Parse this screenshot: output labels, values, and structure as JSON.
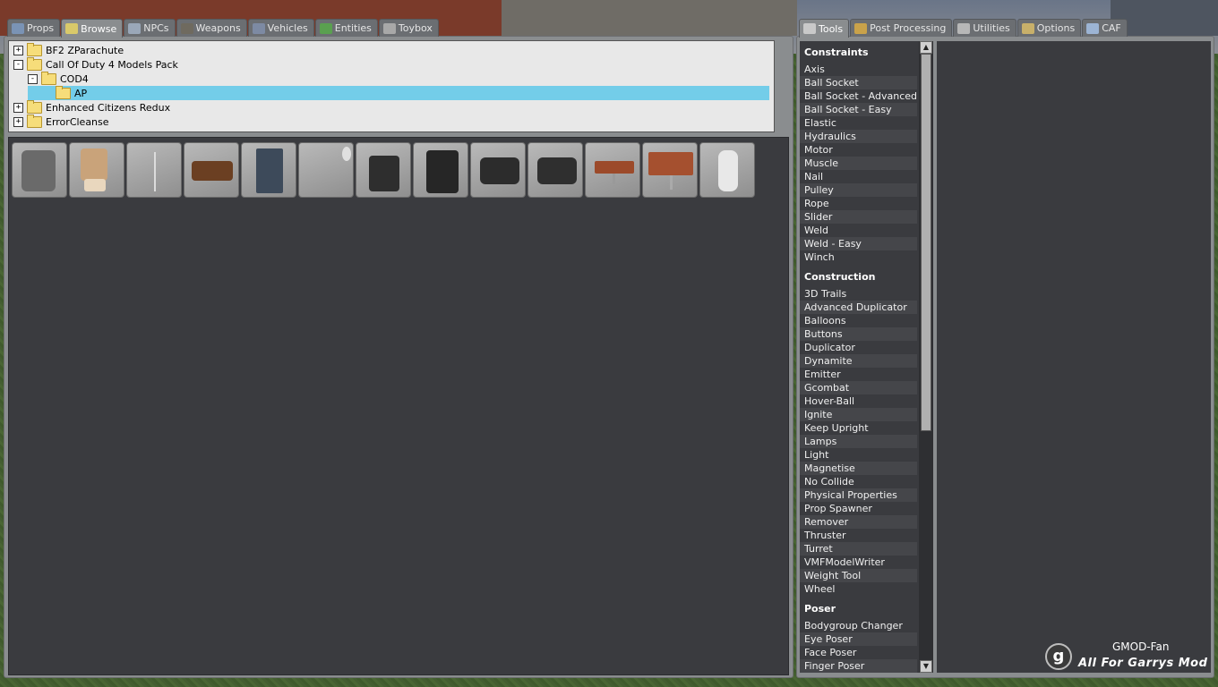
{
  "left_tabs": [
    {
      "label": "Props",
      "icon": "props-icon"
    },
    {
      "label": "Browse",
      "icon": "browse-icon",
      "active": true
    },
    {
      "label": "NPCs",
      "icon": "npcs-icon"
    },
    {
      "label": "Weapons",
      "icon": "weapons-icon"
    },
    {
      "label": "Vehicles",
      "icon": "vehicles-icon"
    },
    {
      "label": "Entities",
      "icon": "entities-icon"
    },
    {
      "label": "Toybox",
      "icon": "toybox-icon"
    }
  ],
  "right_tabs": [
    {
      "label": "Tools",
      "icon": "wrench-icon",
      "active": true
    },
    {
      "label": "Post Processing",
      "icon": "post-processing-icon"
    },
    {
      "label": "Utilities",
      "icon": "utilities-icon"
    },
    {
      "label": "Options",
      "icon": "options-icon"
    },
    {
      "label": "CAF",
      "icon": "caf-icon"
    }
  ],
  "tree": [
    {
      "label": "BF2 ZParachute",
      "expander": "+",
      "level": 0
    },
    {
      "label": "Call Of Duty 4 Models Pack",
      "expander": "-",
      "level": 0
    },
    {
      "label": "COD4",
      "expander": "-",
      "level": 1
    },
    {
      "label": "AP",
      "expander": "",
      "level": 2,
      "selected": true
    },
    {
      "label": "Enhanced Citizens Redux",
      "expander": "+",
      "level": 0
    },
    {
      "label": "ErrorCleanse",
      "expander": "+",
      "level": 0
    }
  ],
  "models": [
    "armchair-model",
    "cinema-seat-model",
    "stand-model",
    "sofa-model",
    "vending-machine-model",
    "blank-model",
    "rolling-luggage-model",
    "tall-luggage-model",
    "suitcase-model",
    "duffel-case-model",
    "small-table-model",
    "square-table-model",
    "tube-model"
  ],
  "categories": [
    {
      "title": "Constraints",
      "items": [
        "Axis",
        "Ball Socket",
        "Ball Socket - Advanced",
        "Ball Socket - Easy",
        "Elastic",
        "Hydraulics",
        "Motor",
        "Muscle",
        "Nail",
        "Pulley",
        "Rope",
        "Slider",
        "Weld",
        "Weld - Easy",
        "Winch"
      ]
    },
    {
      "title": "Construction",
      "items": [
        "3D Trails",
        "Advanced Duplicator",
        "Balloons",
        "Buttons",
        "Duplicator",
        "Dynamite",
        "Emitter",
        "Gcombat",
        "Hover-Ball",
        "Ignite",
        "Keep Upright",
        "Lamps",
        "Light",
        "Magnetise",
        "No Collide",
        "Physical Properties",
        "Prop Spawner",
        "Remover",
        "Thruster",
        "Turret",
        "VMFModelWriter",
        "Weight Tool",
        "Wheel"
      ]
    },
    {
      "title": "Poser",
      "items": [
        "Bodygroup Changer",
        "Eye Poser",
        "Face Poser",
        "Finger Poser"
      ]
    }
  ],
  "watermark": {
    "name": "GMOD-Fan",
    "slogan": "All For Garrys Mod",
    "logo_letter": "g"
  }
}
